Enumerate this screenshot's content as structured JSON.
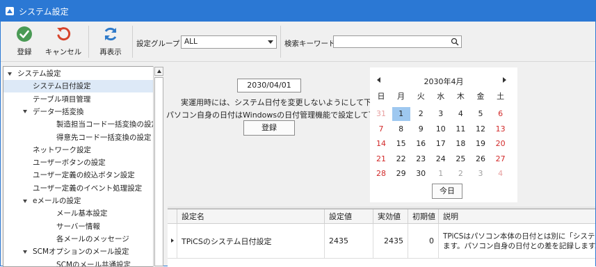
{
  "window": {
    "title": "システム設定"
  },
  "toolbar": {
    "register_label": "登録",
    "cancel_label": "キャンセル",
    "refresh_label": "再表示",
    "group_label": "設定グループ",
    "group_value": "ALL",
    "keyword_label": "検索キーワード",
    "keyword_value": ""
  },
  "tree": {
    "items": [
      {
        "label": "システム設定",
        "level": 0,
        "expanded": true
      },
      {
        "label": "システム日付設定",
        "level": 1,
        "selected": true
      },
      {
        "label": "テーブル項目管理",
        "level": 1
      },
      {
        "label": "データ一括変換",
        "level": 1,
        "expanded": true
      },
      {
        "label": "製造担当コード一括変換の設定",
        "level": 2
      },
      {
        "label": "得意先コード一括変換の設定",
        "level": 2
      },
      {
        "label": "ネットワーク設定",
        "level": 1
      },
      {
        "label": "ユーザーボタンの設定",
        "level": 1
      },
      {
        "label": "ユーザー定義の絞込ボタン設定",
        "level": 1
      },
      {
        "label": "ユーザー定義のイベント処理設定",
        "level": 1
      },
      {
        "label": "eメールの設定",
        "level": 1,
        "expanded": true
      },
      {
        "label": "メール基本設定",
        "level": 2
      },
      {
        "label": "サーバー情報",
        "level": 2
      },
      {
        "label": "各メールのメッセージ",
        "level": 2
      },
      {
        "label": "SCMオプションのメール設定",
        "level": 1,
        "expanded": true
      },
      {
        "label": "SCMのメール共通設定",
        "level": 2
      }
    ]
  },
  "date_setting": {
    "value": "2030/04/01",
    "note1": "実運用時には、システム日付を変更しないようにして下さい",
    "note2": "パソコン自身の日付はWindowsの日付管理機能で設定して下さい",
    "register_label": "登録"
  },
  "calendar": {
    "month_label": "2030年4月",
    "weekdays": [
      "日",
      "月",
      "火",
      "水",
      "木",
      "金",
      "土"
    ],
    "weeks": [
      [
        "31",
        "1",
        "2",
        "3",
        "4",
        "5",
        "6"
      ],
      [
        "7",
        "8",
        "9",
        "10",
        "11",
        "12",
        "13"
      ],
      [
        "14",
        "15",
        "16",
        "17",
        "18",
        "19",
        "20"
      ],
      [
        "21",
        "22",
        "23",
        "24",
        "25",
        "26",
        "27"
      ],
      [
        "28",
        "29",
        "30",
        "1",
        "2",
        "3",
        "4"
      ]
    ],
    "selected_day": "1",
    "today_label": "今日",
    "colors": {
      "weekend": "#d22a2a",
      "other_month": "#a0a0a0",
      "selected_bg": "#9ec8f0"
    }
  },
  "grid": {
    "headers": [
      "設定名",
      "設定値",
      "実効値",
      "初期値",
      "説明"
    ],
    "rows": [
      {
        "name": "TPiCSのシステム日付設定",
        "value": "2435",
        "effective": "2435",
        "initial": "0",
        "desc_line1": "TPiCSはパソコン本体の日付とは別に「システム日付",
        "desc_line2": "ます。パソコン自身の日付との差を記録します。"
      }
    ]
  }
}
